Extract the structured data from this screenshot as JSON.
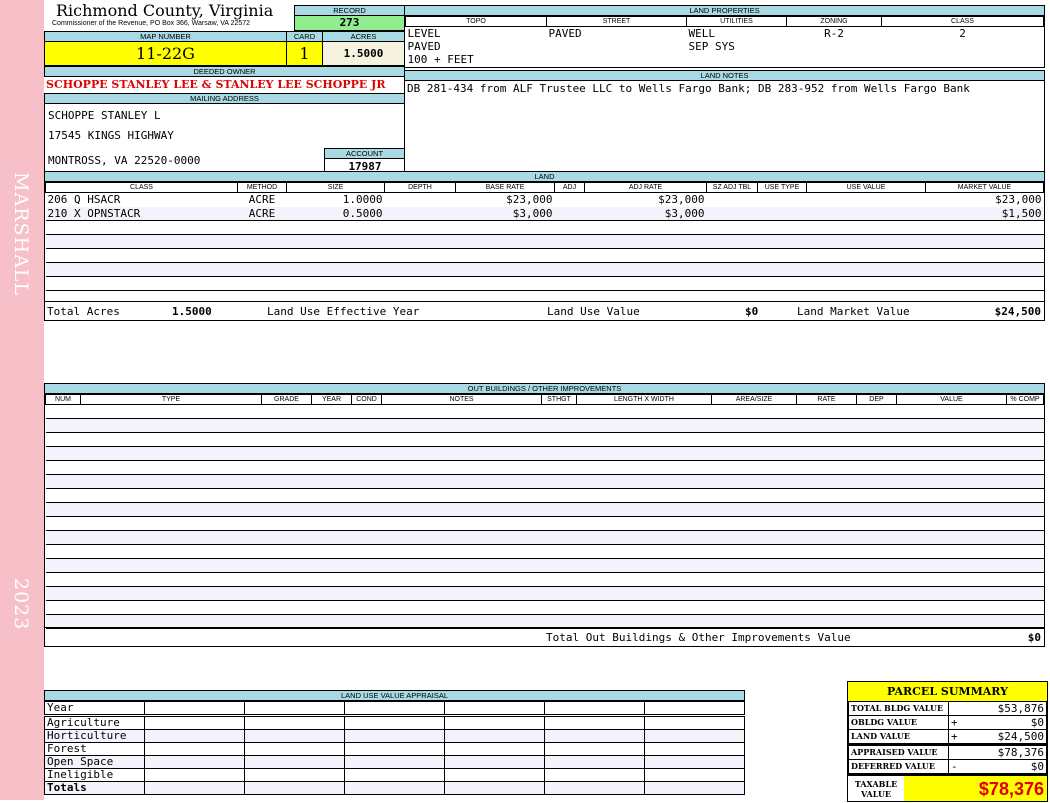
{
  "sidebar": {
    "district": "MARSHALL",
    "year": "2023"
  },
  "header": {
    "title": "Richmond County, Virginia",
    "subtitle": "Commissioner of the Revenue, PO Box 366, Warsaw, VA 22572"
  },
  "record": {
    "label": "RECORD",
    "value": "273"
  },
  "map": {
    "label": "MAP NUMBER",
    "value": "11-22G"
  },
  "card": {
    "label": "CARD",
    "value": "1"
  },
  "acres": {
    "label": "ACRES",
    "value": "1.5000"
  },
  "owner": {
    "label": "DEEDED OWNER",
    "value": "SCHOPPE STANLEY LEE & STANLEY LEE SCHOPPE JR"
  },
  "mailing": {
    "label": "MAILING ADDRESS",
    "line1": "SCHOPPE STANLEY L",
    "line2": "17545 KINGS HIGHWAY",
    "line3": "MONTROSS, VA 22520-0000"
  },
  "account": {
    "label": "ACCOUNT",
    "value": "17987"
  },
  "land_properties": {
    "label": "LAND PROPERTIES",
    "columns": [
      "TOPO",
      "STREET",
      "UTILITIES",
      "ZONING",
      "CLASS"
    ],
    "rows": [
      [
        "LEVEL",
        "PAVED",
        "WELL",
        "R-2",
        "2"
      ],
      [
        "PAVED",
        "",
        "SEP SYS",
        "",
        ""
      ],
      [
        "100 + FEET",
        "",
        "",
        "",
        ""
      ]
    ]
  },
  "land_notes": {
    "label": "LAND NOTES",
    "text": "DB 281-434 from ALF Trustee LLC to Wells Fargo Bank; DB 283-952 from Wells Fargo Bank"
  },
  "land": {
    "label": "LAND",
    "columns": [
      "CLASS",
      "METHOD",
      "SIZE",
      "DEPTH",
      "BASE RATE",
      "ADJ",
      "ADJ RATE",
      "SZ ADJ TBL",
      "USE TYPE",
      "USE VALUE",
      "MARKET VALUE"
    ],
    "rows": [
      [
        "206 Q HSACR",
        "ACRE",
        "1.0000",
        "",
        "$23,000",
        "",
        "$23,000",
        "",
        "",
        "",
        "$23,000"
      ],
      [
        "210 X OPNSTACR",
        "ACRE",
        "0.5000",
        "",
        "$3,000",
        "",
        "$3,000",
        "",
        "",
        "",
        "$1,500"
      ]
    ],
    "totals": {
      "acres_label": "Total Acres",
      "acres": "1.5000",
      "eff_year_label": "Land Use Effective Year",
      "use_value_label": "Land Use Value",
      "use_value": "$0",
      "market_label": "Land Market Value",
      "market": "$24,500"
    }
  },
  "outbuildings": {
    "label": "OUT BUILDINGS / OTHER IMPROVEMENTS",
    "columns": [
      "NUM",
      "TYPE",
      "GRADE",
      "YEAR",
      "COND",
      "NOTES",
      "STHGT",
      "LENGTH X WIDTH",
      "AREA/SIZE",
      "RATE",
      "DEP",
      "VALUE",
      "% COMP"
    ],
    "total_label": "Total Out Buildings & Other Improvements Value",
    "total": "$0"
  },
  "land_use": {
    "label": "LAND USE VALUE APPRAISAL",
    "year_label": "Year",
    "rows": [
      "Agriculture",
      "Horticulture",
      "Forest",
      "Open Space",
      "Ineligible"
    ],
    "totals_label": "Totals"
  },
  "summary": {
    "title": "PARCEL SUMMARY",
    "rows": [
      {
        "label": "TOTAL BLDG VALUE",
        "op": "",
        "value": "$53,876"
      },
      {
        "label": "OBLDG VALUE",
        "op": "+",
        "value": "$0"
      },
      {
        "label": "LAND VALUE",
        "op": "+",
        "value": "$24,500"
      },
      {
        "label": "APPRAISED VALUE",
        "op": "",
        "value": "$78,376"
      },
      {
        "label": "DEFERRED VALUE",
        "op": "-",
        "value": "$0"
      }
    ],
    "taxable_label": "TAXABLE VALUE",
    "taxable": "$78,376"
  },
  "colors": {
    "header_blue": "#a9d9e3",
    "yellow": "#ffff00",
    "green": "#90ee90",
    "red": "#e00000",
    "sidebar_pink": "#f7c0c8"
  }
}
